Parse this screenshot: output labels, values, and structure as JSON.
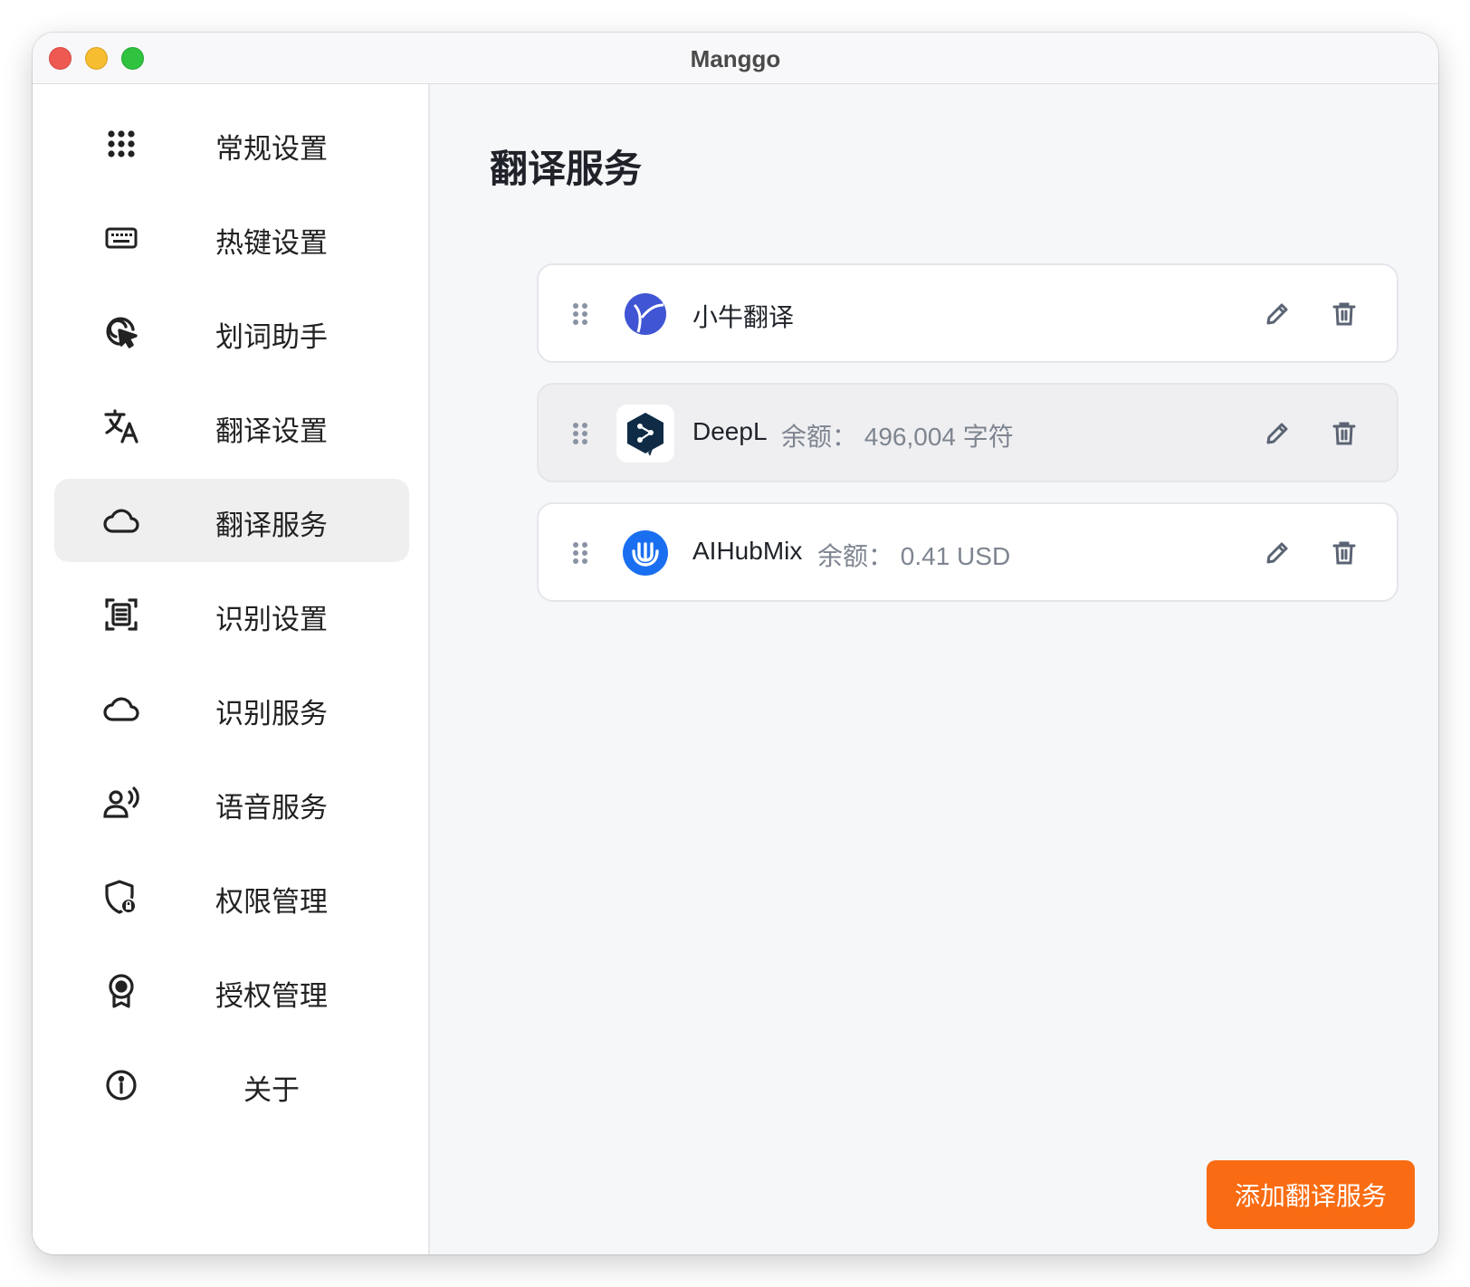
{
  "window": {
    "title": "Manggo"
  },
  "sidebar": {
    "items": [
      {
        "label": "常规设置",
        "icon": "grid-icon"
      },
      {
        "label": "热键设置",
        "icon": "keyboard-icon"
      },
      {
        "label": "划词助手",
        "icon": "cursor-click-icon"
      },
      {
        "label": "翻译设置",
        "icon": "translate-icon"
      },
      {
        "label": "翻译服务",
        "icon": "cloud-icon",
        "active": true
      },
      {
        "label": "识别设置",
        "icon": "scan-text-icon"
      },
      {
        "label": "识别服务",
        "icon": "cloud-icon"
      },
      {
        "label": "语音服务",
        "icon": "voice-user-icon"
      },
      {
        "label": "权限管理",
        "icon": "shield-lock-icon"
      },
      {
        "label": "授权管理",
        "icon": "badge-award-icon"
      },
      {
        "label": "关于",
        "icon": "info-icon"
      }
    ]
  },
  "main": {
    "title": "翻译服务",
    "services": [
      {
        "name": "小牛翻译",
        "balance": "",
        "logo": "niutrans-logo-icon"
      },
      {
        "name": "DeepL",
        "balance": "余额： 496,004 字符",
        "logo": "deepl-logo-icon"
      },
      {
        "name": "AIHubMix",
        "balance": "余额： 0.41 USD",
        "logo": "aihubmix-logo-icon"
      }
    ],
    "add_button": "添加翻译服务"
  },
  "colors": {
    "accent": "#f96c13",
    "active_nav_bg": "#efefef",
    "card_border": "#e4e6ea",
    "muted_text": "#7e8590",
    "icon_gray": "#5b6474"
  }
}
